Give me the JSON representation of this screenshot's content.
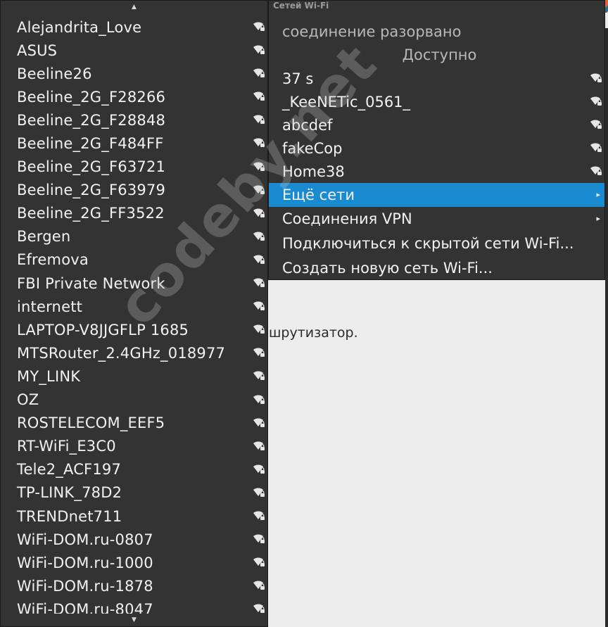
{
  "background": {
    "partial_text": "шрутизатор."
  },
  "network_list": {
    "items": [
      {
        "label": "Alejandrita_Love",
        "icon": "wifi-secure-icon"
      },
      {
        "label": "ASUS",
        "icon": "wifi-secure-icon"
      },
      {
        "label": "Beeline26",
        "icon": "wifi-secure-icon"
      },
      {
        "label": "Beeline_2G_F28266",
        "icon": "wifi-secure-icon"
      },
      {
        "label": "Beeline_2G_F28848",
        "icon": "wifi-secure-icon"
      },
      {
        "label": "Beeline_2G_F484FF",
        "icon": "wifi-secure-icon"
      },
      {
        "label": "Beeline_2G_F63721",
        "icon": "wifi-secure-icon"
      },
      {
        "label": "Beeline_2G_F63979",
        "icon": "wifi-secure-icon"
      },
      {
        "label": "Beeline_2G_FF3522",
        "icon": "wifi-secure-icon"
      },
      {
        "label": "Bergen",
        "icon": "wifi-secure-icon"
      },
      {
        "label": "Efremova",
        "icon": "wifi-secure-icon"
      },
      {
        "label": "FBI Private Network",
        "icon": "wifi-secure-icon"
      },
      {
        "label": "internett",
        "icon": "wifi-secure-icon"
      },
      {
        "label": "LAPTOP-V8JJGFLP 1685",
        "icon": "wifi-secure-icon"
      },
      {
        "label": "MTSRouter_2.4GHz_018977",
        "icon": "wifi-secure-icon"
      },
      {
        "label": "MY_LINK",
        "icon": "wifi-secure-icon"
      },
      {
        "label": "OZ",
        "icon": "wifi-secure-icon"
      },
      {
        "label": "ROSTELECOM_EEF5",
        "icon": "wifi-secure-icon"
      },
      {
        "label": "RT-WiFi_E3C0",
        "icon": "wifi-secure-icon"
      },
      {
        "label": "Tele2_ACF197",
        "icon": "wifi-secure-icon"
      },
      {
        "label": "TP-LINK_78D2",
        "icon": "wifi-secure-icon"
      },
      {
        "label": "TRENDnet711",
        "icon": "wifi-secure-icon"
      },
      {
        "label": "WiFi-DOM.ru-0807",
        "icon": "wifi-secure-icon"
      },
      {
        "label": "WiFi-DOM.ru-1000",
        "icon": "wifi-secure-icon"
      },
      {
        "label": "WiFi-DOM.ru-1878",
        "icon": "wifi-secure-icon"
      },
      {
        "label": "WiFi-DOM.ru-8047",
        "icon": "wifi-secure-icon"
      }
    ],
    "scroll_up_icon": "▲",
    "scroll_down_icon": "▼"
  },
  "menu": {
    "header": "Сетей Wi-Fi",
    "status": "соединение разорвано",
    "section": "Доступно",
    "networks": [
      {
        "label": "37 s"
      },
      {
        "label": "_KeeNETic_0561_"
      },
      {
        "label": "abcdef"
      },
      {
        "label": "fakeCop"
      },
      {
        "label": "Home38"
      }
    ],
    "more_networks": "Ещё сети",
    "vpn": "Соединения VPN",
    "connect_hidden": "Подключиться к скрытой сети Wi-Fi...",
    "create_new": "Создать новую сеть Wi-Fi..."
  },
  "watermark": "codeby.net",
  "colors": {
    "menu_bg": "#333333",
    "highlight": "#1a8bd0",
    "text": "#f2f2f2",
    "dim_text": "#b8b8b8"
  }
}
